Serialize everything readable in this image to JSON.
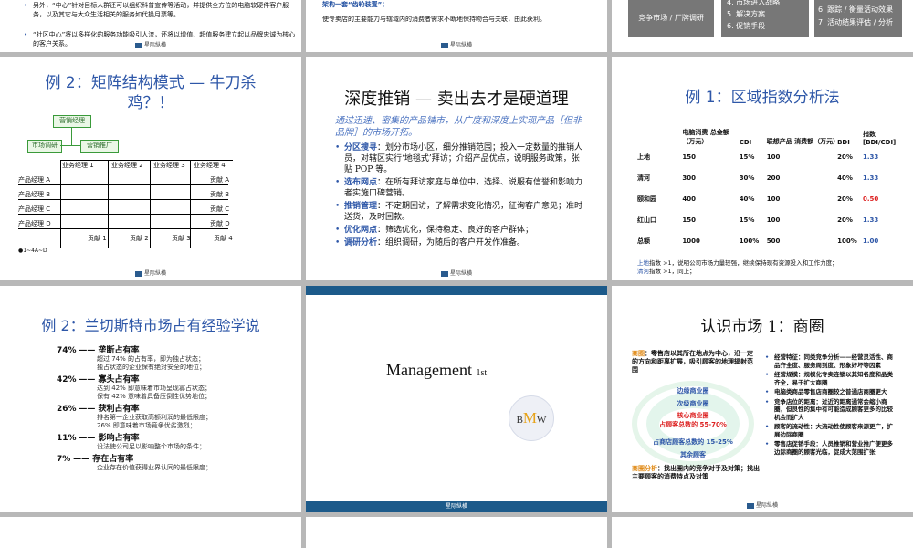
{
  "s1": {
    "lines": [
      "另外，“中心”针对目标人群还可以组织科普宣传等活动，并提供全方位的电脑软硬件客户服务，以及其它与大众生活相关的服务如代换月票等。",
      "“社区中心”将以多样化的服务功能吸引人流，还将以增值、超值服务建立起以品牌忠诚为核心的客户关系。"
    ],
    "footer": "星际纵横"
  },
  "s2": {
    "heading": "架构一套“齿轮装置”：",
    "body": "使专卖店的主要能力与辖域内的消费者需求不断地保持吻合与关联，由此获利。",
    "footer": "星际纵横"
  },
  "s3": {
    "left_btn": "竞争市场 / 厂牌调研",
    "mid_items": [
      "4. 市场进入战略",
      "5. 解决方案",
      "6. 促销手段"
    ],
    "right_items": [
      "6. 跟踪 / 衡量活动效果",
      "7. 活动结果评估 / 分析"
    ]
  },
  "s4": {
    "title": "例 2：矩阵结构模式 — 牛刀杀鸡？！",
    "box_mgr": "营销经理",
    "box_research": "市场调研",
    "box_promo": "营销推广",
    "col_headers": [
      "业务经理 1",
      "业务经理 2",
      "业务经理 3",
      "业务经理 4"
    ],
    "rows": [
      "产品经理 A",
      "产品经理 B",
      "产品经理 C",
      "产品经理 D"
    ],
    "contrib_right": [
      "贡献 A",
      "贡献 B",
      "贡献 C",
      "贡献 D"
    ],
    "contrib_bottom": [
      "贡献 1",
      "贡献 2",
      "贡献 3",
      "贡献 4"
    ],
    "note": "1~4A~D",
    "footer": "星际纵横"
  },
  "s5": {
    "title": "深度推销 — 卖出去才是硬道理",
    "subtitle": "通过迅速、密集的产品铺市，从广度和深度上实现产品［但非品牌］的市场开拓。",
    "bullets": [
      {
        "label": "分区搜寻",
        "text": "：划分市场小区，细分推销范围；投入一定数量的推销人员，对辖区实行‘地毯式’拜访；介绍产品优点，说明服务政策，张贴 POP 等。"
      },
      {
        "label": "选布网点",
        "text": "：在所有拜访家庭与单位中，选择、说服有信誉和影响力者实施口碑营销。"
      },
      {
        "label": "推销管理",
        "text": "：不定期回访，了解需求变化情况，征询客户意见；准时送货，及时回款。"
      },
      {
        "label": "优化网点",
        "text": "：筛选优化，保持稳定、良好的客户群体；"
      },
      {
        "label": "调研分析",
        "text": "：组织调研，为随后的客户开发作准备。"
      }
    ],
    "footer": "星际纵横"
  },
  "s6": {
    "title": "例 1：区域指数分析法",
    "headers": [
      "电脑消费 总金额（万元）",
      "CDI",
      "联想产品 消费额（万元）",
      "BDI",
      "指数 [BDI/CDI]"
    ],
    "rows": [
      {
        "region": "上地",
        "total": "150",
        "cdi": "15%",
        "lenovo": "100",
        "bdi": "20%",
        "idx": "1.33"
      },
      {
        "region": "清河",
        "total": "300",
        "cdi": "30%",
        "lenovo": "200",
        "bdi": "40%",
        "idx": "1.33"
      },
      {
        "region": "颐和园",
        "total": "400",
        "cdi": "40%",
        "lenovo": "100",
        "bdi": "20%",
        "idx": "0.50"
      },
      {
        "region": "红山口",
        "total": "150",
        "cdi": "15%",
        "lenovo": "100",
        "bdi": "20%",
        "idx": "1.33"
      },
      {
        "region": "总额",
        "total": "1000",
        "cdi": "100%",
        "lenovo": "500",
        "bdi": "100%",
        "idx": "1.00"
      }
    ],
    "note1_place": "上地",
    "note1": "指数 >1，说明公司市场力量较强，继续保持现有资源投入和工作力度；",
    "note2_place": "清河",
    "note2": "指数 >1，同上；",
    "footer": "星际纵横"
  },
  "s7": {
    "title": "例 2：兰切斯特市场占有经验学说",
    "items": [
      {
        "pct": "74%",
        "name": "—— 垄断占有率",
        "desc": [
          "超过 74% 的占有率，即为独占状态；",
          "独占状态的企业保有绝对安全的地位；"
        ]
      },
      {
        "pct": "42%",
        "name": "—— 寡头占有率",
        "desc": [
          "达到 42% 即意味着市场呈现寡占状态；",
          "保有 42% 意味着具备压倒性优势地位；"
        ]
      },
      {
        "pct": "26%",
        "name": "—— 获利占有率",
        "desc": [
          "排名第一企业获取高额利润的最低限度；",
          "26% 即意味着市场竞争优劣激烈；"
        ]
      },
      {
        "pct": "11%",
        "name": "—— 影响占有率",
        "desc": [
          "设法使公司足以影响整个市场的条件；"
        ]
      },
      {
        "pct": "7%",
        "name": "—— 存在占有率",
        "desc": [
          "企业存在价值获得业界认同的最低限度；"
        ]
      }
    ],
    "footer": "星际纵横"
  },
  "s8": {
    "title": "Management",
    "sup": "1st",
    "logo_b": "B",
    "logo_m": "M",
    "logo_w": "W",
    "footer": "星际纵横"
  },
  "s9": {
    "title": "认识市场 1：商圈",
    "intro_label": "商圈",
    "intro": "：零售店以其所在地点为中心，沿一定的方向和距离扩展，吸引顾客的地理辐射范围",
    "rings": [
      "边缘商业圈",
      "次级商业圈",
      "核心商业圈",
      "占顾客总数的 55-70%",
      "占商店顾客总数的 15-25%",
      "其余顾客"
    ],
    "bottom_label": "商圈分析",
    "bottom": "：找出圈内的竞争对手及对策；找出主要顾客的消费特点及对策",
    "right": [
      "经营特征：同类竞争分析——经营灵活性、商品齐全度、服务周到度、形象好坏等因素",
      "经营规模：规模化专卖连锁以其知名度和品类齐全，易于扩大商圈",
      "电脑类商品零售店商圈较之普通店商圈更大",
      "竞争店位的距离：过近的距离通常会缩小商圈，但良性的集中有可能造成顾客更多的比较机会而扩大",
      "顾客的流动性：大流动性使顾客来源更广，扩展边际商圈",
      "零售店促销手段：人员推销和营业推广便更多边际商圈的顾客光临，促成大范围扩张"
    ],
    "footer": "星际纵横"
  }
}
